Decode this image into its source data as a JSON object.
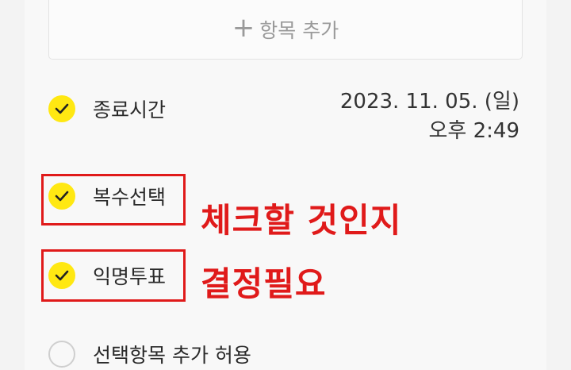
{
  "add_item": {
    "icon": "plus-icon",
    "label": "항목 추가"
  },
  "options": {
    "end_time": {
      "label": "종료시간",
      "checked": true,
      "date": "2023. 11. 05. (일)",
      "time": "오후 2:49"
    },
    "multi_select": {
      "label": "복수선택",
      "checked": true
    },
    "anonymous": {
      "label": "익명투표",
      "checked": true
    },
    "allow_add": {
      "label": "선택항목 추가 허용",
      "checked": false
    }
  },
  "annotations": {
    "line1": "체크할 것인지",
    "line2": "결정필요",
    "color": "#e01a1a"
  },
  "colors": {
    "check_on": "#ffe812",
    "text": "#2a2a2a",
    "muted": "#9a9a9a"
  }
}
